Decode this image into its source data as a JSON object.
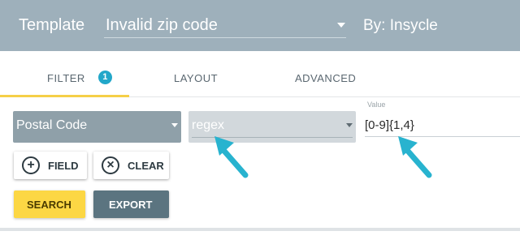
{
  "header": {
    "template_label": "Template",
    "template_value": "Invalid zip code",
    "author": "By: Insycle"
  },
  "tabs": [
    {
      "label": "FILTER",
      "badge": "1"
    },
    {
      "label": "LAYOUT"
    },
    {
      "label": "ADVANCED"
    }
  ],
  "filter": {
    "field_value": "Postal Code",
    "operator_value": "regex",
    "value_label": "Value",
    "value": "[0-9]{1,4}"
  },
  "buttons": {
    "field": "FIELD",
    "clear": "CLEAR",
    "search": "SEARCH",
    "export": "EXPORT"
  },
  "colors": {
    "header_bg": "#9eb0bb",
    "accent_tab": "#f5cf47",
    "badge": "#22a7c9",
    "arrow": "#28b3cf",
    "search_button": "#fcd744",
    "export_button": "#5b7480"
  }
}
